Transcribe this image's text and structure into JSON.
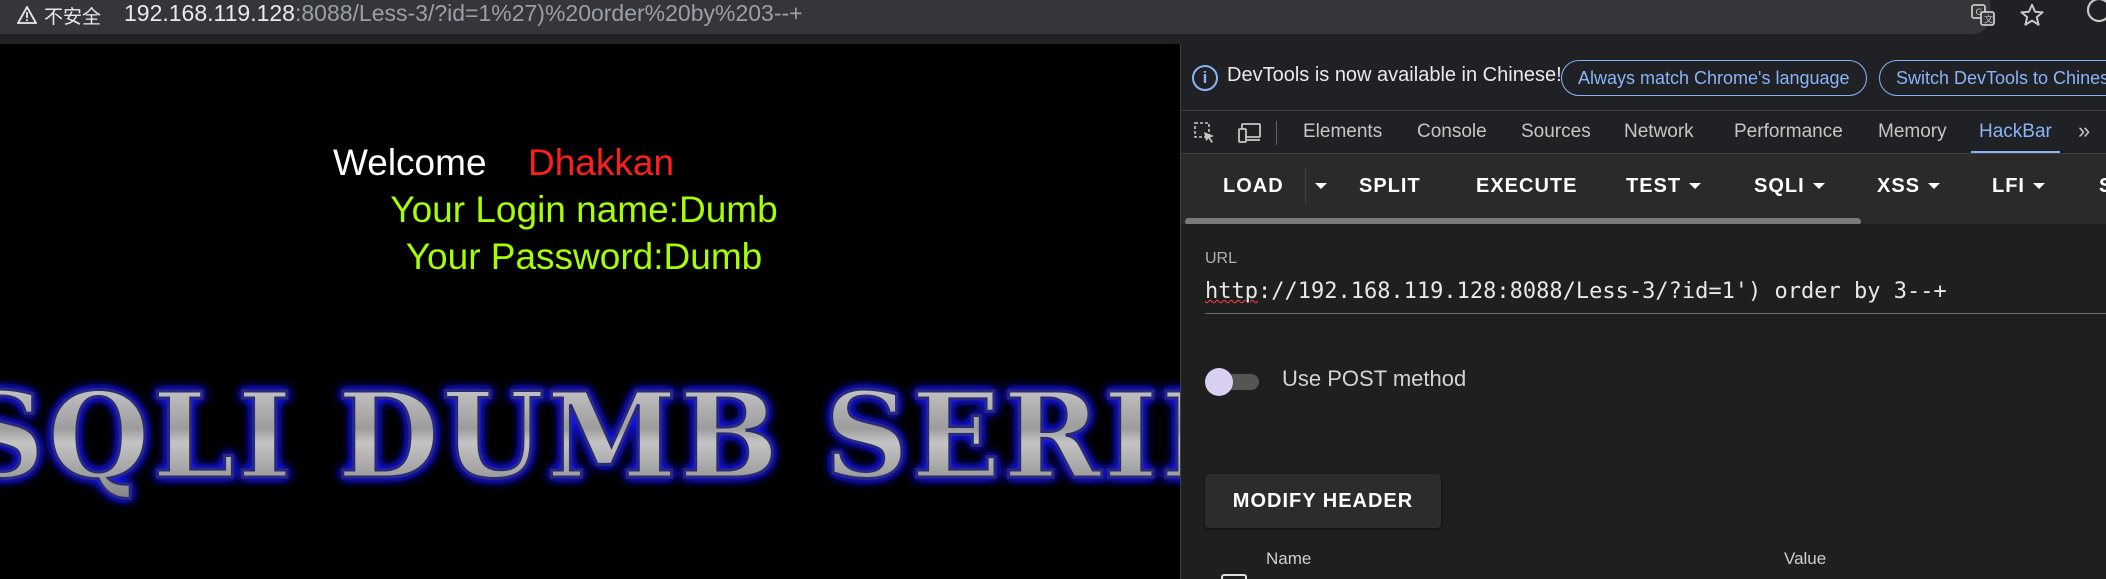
{
  "addressbar": {
    "security_label": "不安全",
    "url_host": "192.168.119.128",
    "url_rest": ":8088/Less-3/?id=1%27)%20order%20by%203--+",
    "icons": [
      "warning-icon",
      "translate-icon",
      "star-icon",
      "profile-icon"
    ]
  },
  "page": {
    "welcome_word": "Welcome",
    "welcome_name": "Dhakkan",
    "login_line": "Your Login name:Dumb",
    "password_line": "Your Password:Dumb",
    "banner_text": "SQLI DUMB SERIES",
    "colors": {
      "welcome": "#ffffff",
      "name": "#ff1d1d",
      "credentials": "#a6ff00",
      "banner_glow": "#1a1aff"
    }
  },
  "devtools": {
    "notice": {
      "text": "DevTools is now available in Chinese!",
      "button_match": "Always match Chrome's language",
      "button_switch": "Switch DevTools to Chinese"
    },
    "tabs": [
      "Elements",
      "Console",
      "Sources",
      "Network",
      "Performance",
      "Memory",
      "HackBar"
    ],
    "active_tab": "HackBar",
    "more_tabs": "»",
    "accent": "#8ab4f8"
  },
  "hackbar": {
    "buttons": {
      "load": "LOAD",
      "split": "SPLIT",
      "execute": "EXECUTE",
      "test": "TEST",
      "sqli": "SQLI",
      "xss": "XSS",
      "lfi": "LFI",
      "ssti": "S"
    },
    "url_label": "URL",
    "url_value_prefix": "http",
    "url_value_rest": "://192.168.119.128:8088/Less-3/?id=1') order by 3--+",
    "post_label": "Use POST method",
    "post_enabled": false,
    "modify_header": "MODIFY HEADER",
    "header_columns": {
      "name": "Name",
      "value": "Value"
    }
  }
}
